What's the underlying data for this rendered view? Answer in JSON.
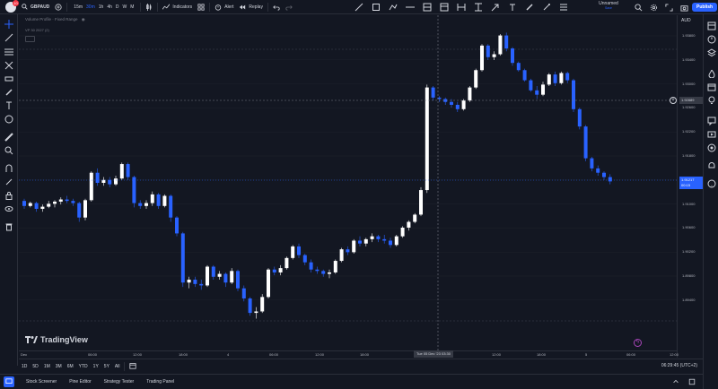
{
  "toolbar": {
    "symbol": "GBPAUD",
    "avatar_badge": "10",
    "intervals": [
      "15m",
      "30m",
      "1h",
      "4h",
      "D",
      "W",
      "M"
    ],
    "active_interval": "30m",
    "indicators_label": "Indicators",
    "alert_label": "Alert",
    "replay_label": "Replay",
    "layout_name": "Unnamed",
    "layout_status": "Save",
    "publish_label": "Publish"
  },
  "legend": {
    "indicator": "Volume Profile · Fixed Range",
    "sub": "VP 30 2027 (2)"
  },
  "price_axis": {
    "currency": "AUD",
    "ticks": [
      "1.93800",
      "1.93400",
      "1.93000",
      "1.92600",
      "1.92200",
      "1.91800",
      "1.91400",
      "1.91000",
      "1.90600",
      "1.90200",
      "1.89800",
      "1.89400"
    ],
    "crosshair_price": "1.92889",
    "last_price": "1.91217",
    "last_countdown": "00:15"
  },
  "time_axis": {
    "ticks": [
      "Dec",
      "06:00",
      "12:00",
      "18:00",
      "4",
      "06:00",
      "12:00",
      "18:00",
      "12:00",
      "18:00",
      "5",
      "06:00",
      "12:00"
    ],
    "crosshair_time": "Tue 05 Dec '23   03:30"
  },
  "logo_text": "TradingView",
  "range_bar": {
    "ranges": [
      "1D",
      "5D",
      "1M",
      "3M",
      "6M",
      "YTD",
      "1Y",
      "5Y",
      "All"
    ],
    "clock": "06:29:45 (UTC+2)"
  },
  "footer": {
    "tabs": [
      "Stock Screener",
      "Pine Editor",
      "Strategy Tester",
      "Trading Panel"
    ]
  },
  "colors": {
    "up": "#ffffff",
    "down": "#2962ff",
    "accent": "#2962ff",
    "background": "#131722"
  },
  "chart_data": {
    "type": "candlestick",
    "y_range": [
      1.8932,
      1.9396
    ],
    "candles": [
      [
        1.9139,
        1.9142,
        1.9128,
        1.9132
      ],
      [
        1.9132,
        1.9138,
        1.913,
        1.9136
      ],
      [
        1.9136,
        1.9138,
        1.9124,
        1.9128
      ],
      [
        1.9128,
        1.9134,
        1.9124,
        1.9131
      ],
      [
        1.9131,
        1.9139,
        1.9129,
        1.9135
      ],
      [
        1.9135,
        1.914,
        1.913,
        1.9138
      ],
      [
        1.9138,
        1.9144,
        1.9134,
        1.9141
      ],
      [
        1.9141,
        1.9146,
        1.9136,
        1.9139
      ],
      [
        1.9139,
        1.9142,
        1.9132,
        1.9136
      ],
      [
        1.9136,
        1.9138,
        1.911,
        1.9116
      ],
      [
        1.9116,
        1.9142,
        1.9112,
        1.914
      ],
      [
        1.914,
        1.918,
        1.9138,
        1.9178
      ],
      [
        1.9178,
        1.9184,
        1.916,
        1.9164
      ],
      [
        1.9164,
        1.9172,
        1.916,
        1.9168
      ],
      [
        1.9168,
        1.9172,
        1.9158,
        1.9162
      ],
      [
        1.9162,
        1.9174,
        1.916,
        1.917
      ],
      [
        1.917,
        1.9192,
        1.9168,
        1.919
      ],
      [
        1.919,
        1.9192,
        1.9168,
        1.9172
      ],
      [
        1.9172,
        1.9174,
        1.913,
        1.9136
      ],
      [
        1.9136,
        1.914,
        1.9128,
        1.9132
      ],
      [
        1.9132,
        1.914,
        1.9128,
        1.9136
      ],
      [
        1.9136,
        1.9152,
        1.9132,
        1.9148
      ],
      [
        1.9148,
        1.915,
        1.9128,
        1.9132
      ],
      [
        1.9132,
        1.9148,
        1.913,
        1.9146
      ],
      [
        1.9146,
        1.9148,
        1.911,
        1.9116
      ],
      [
        1.9116,
        1.9118,
        1.909,
        1.9094
      ],
      [
        1.9094,
        1.9096,
        1.902,
        1.9026
      ],
      [
        1.9026,
        1.9034,
        1.9018,
        1.903
      ],
      [
        1.903,
        1.9034,
        1.902,
        1.9024
      ],
      [
        1.9024,
        1.903,
        1.9016,
        1.9022
      ],
      [
        1.9022,
        1.905,
        1.902,
        1.9048
      ],
      [
        1.9048,
        1.905,
        1.903,
        1.9034
      ],
      [
        1.9034,
        1.9042,
        1.903,
        1.9038
      ],
      [
        1.9038,
        1.904,
        1.902,
        1.9026
      ],
      [
        1.9026,
        1.9046,
        1.9024,
        1.9042
      ],
      [
        1.9042,
        1.9044,
        1.9014,
        1.9018
      ],
      [
        1.9018,
        1.9022,
        1.9,
        1.9004
      ],
      [
        1.9004,
        1.9006,
        1.898,
        1.8984
      ],
      [
        1.8984,
        1.8992,
        1.8976,
        1.8986
      ],
      [
        1.8986,
        1.901,
        1.8984,
        1.9006
      ],
      [
        1.9006,
        1.9046,
        1.9004,
        1.9044
      ],
      [
        1.9044,
        1.9048,
        1.9036,
        1.904
      ],
      [
        1.904,
        1.905,
        1.9036,
        1.9046
      ],
      [
        1.9046,
        1.9062,
        1.9044,
        1.906
      ],
      [
        1.906,
        1.9078,
        1.9058,
        1.9076
      ],
      [
        1.9076,
        1.908,
        1.906,
        1.9064
      ],
      [
        1.9064,
        1.9066,
        1.905,
        1.9054
      ],
      [
        1.9054,
        1.9058,
        1.904,
        1.9044
      ],
      [
        1.9044,
        1.9048,
        1.9038,
        1.9042
      ],
      [
        1.9042,
        1.9044,
        1.9034,
        1.9038
      ],
      [
        1.9038,
        1.9044,
        1.9032,
        1.904
      ],
      [
        1.904,
        1.9058,
        1.9038,
        1.9056
      ],
      [
        1.9056,
        1.9074,
        1.9054,
        1.9072
      ],
      [
        1.9072,
        1.9076,
        1.9064,
        1.9068
      ],
      [
        1.9068,
        1.9086,
        1.9066,
        1.9084
      ],
      [
        1.9084,
        1.909,
        1.9076,
        1.908
      ],
      [
        1.908,
        1.9088,
        1.9076,
        1.9086
      ],
      [
        1.9086,
        1.9094,
        1.9082,
        1.909
      ],
      [
        1.909,
        1.9092,
        1.9082,
        1.9086
      ],
      [
        1.9086,
        1.9092,
        1.908,
        1.9084
      ],
      [
        1.9084,
        1.9088,
        1.9074,
        1.9078
      ],
      [
        1.9078,
        1.9092,
        1.9076,
        1.909
      ],
      [
        1.909,
        1.9104,
        1.9088,
        1.9102
      ],
      [
        1.9102,
        1.9112,
        1.9098,
        1.911
      ],
      [
        1.911,
        1.9122,
        1.9108,
        1.912
      ],
      [
        1.912,
        1.9158,
        1.9118,
        1.9154
      ],
      [
        1.9154,
        1.93,
        1.915,
        1.9296
      ],
      [
        1.9296,
        1.9298,
        1.9278,
        1.9282
      ],
      [
        1.9282,
        1.9284,
        1.9276,
        1.928
      ],
      [
        1.928,
        1.9282,
        1.9272,
        1.9276
      ],
      [
        1.9276,
        1.928,
        1.9268,
        1.9272
      ],
      [
        1.9272,
        1.9276,
        1.9262,
        1.9266
      ],
      [
        1.9266,
        1.928,
        1.9264,
        1.9278
      ],
      [
        1.9278,
        1.9298,
        1.9276,
        1.9296
      ],
      [
        1.9296,
        1.9322,
        1.9294,
        1.932
      ],
      [
        1.932,
        1.9356,
        1.9318,
        1.9354
      ],
      [
        1.9354,
        1.9356,
        1.9334,
        1.9338
      ],
      [
        1.9338,
        1.9346,
        1.9334,
        1.9342
      ],
      [
        1.9342,
        1.937,
        1.934,
        1.9368
      ],
      [
        1.9368,
        1.9372,
        1.9346,
        1.935
      ],
      [
        1.935,
        1.9352,
        1.9326,
        1.933
      ],
      [
        1.933,
        1.9332,
        1.9318,
        1.932
      ],
      [
        1.932,
        1.9322,
        1.9304,
        1.9306
      ],
      [
        1.9306,
        1.9308,
        1.929,
        1.9292
      ],
      [
        1.9292,
        1.9298,
        1.928,
        1.9286
      ],
      [
        1.9286,
        1.9304,
        1.9284,
        1.93
      ],
      [
        1.93,
        1.9316,
        1.9298,
        1.9314
      ],
      [
        1.9314,
        1.9318,
        1.9298,
        1.9302
      ],
      [
        1.9302,
        1.9318,
        1.93,
        1.9316
      ],
      [
        1.9316,
        1.9318,
        1.9302,
        1.9306
      ],
      [
        1.9306,
        1.9308,
        1.9262,
        1.9266
      ],
      [
        1.9266,
        1.9268,
        1.9238,
        1.9242
      ],
      [
        1.9242,
        1.9244,
        1.9194,
        1.9198
      ],
      [
        1.9198,
        1.92,
        1.918,
        1.9184
      ],
      [
        1.9184,
        1.9188,
        1.9174,
        1.9178
      ],
      [
        1.9178,
        1.918,
        1.9168,
        1.9172
      ],
      [
        1.9172,
        1.9176,
        1.9162,
        1.9166
      ]
    ]
  }
}
